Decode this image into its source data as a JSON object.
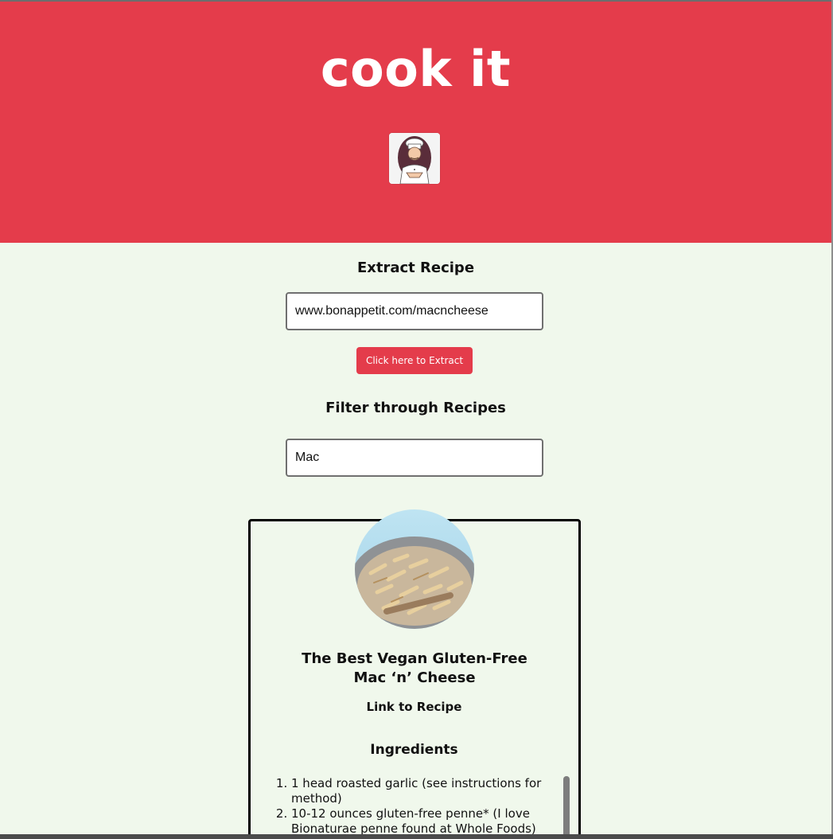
{
  "header": {
    "title": "cook it",
    "logo_icon": "chef-icon",
    "background_color": "#e43c4b"
  },
  "extract": {
    "heading": "Extract Recipe",
    "input_value": "www.bonappetit.com/macncheese",
    "button_label": "Click here to Extract"
  },
  "filter": {
    "heading": "Filter through Recipes",
    "input_value": "Mac"
  },
  "recipe": {
    "photo_icon": "pasta-photo",
    "title": "The Best Vegan Gluten-Free Mac ‘n’ Cheese",
    "link_label": "Link to Recipe",
    "ingredients_heading": "Ingredients",
    "ingredients": [
      "1 head roasted garlic (see instructions for method)",
      "10-12 ounces gluten-free penne* (I love Bionaturae penne found at Whole Foods)"
    ]
  },
  "colors": {
    "accent": "#e43c4b",
    "page_background": "#f0f8ec"
  }
}
